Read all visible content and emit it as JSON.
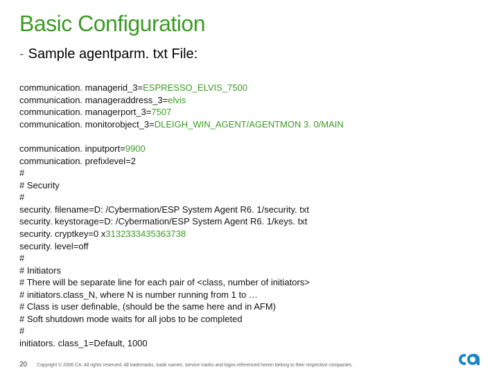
{
  "title": "Basic Configuration",
  "subtitle_dash": "-",
  "subtitle": "Sample agentparm. txt File:",
  "block1": [
    {
      "key": "communication. managerid_3",
      "value": "ESPRESSO_ELVIS_7500",
      "green": true
    },
    {
      "key": "communication. manageraddress_3",
      "value": "elvis",
      "green": true
    },
    {
      "key": "communication. managerport_3",
      "value": "7507",
      "green": true
    },
    {
      "key": "communication. monitorobject_3",
      "value": "DLEIGH_WIN_AGENT/AGENTMON 3. 0/MAIN",
      "green": true
    }
  ],
  "block2": [
    {
      "key": "communication. inputport",
      "value": "9900",
      "green": true
    },
    {
      "key": "communication. prefixlevel",
      "value": "2",
      "green": false
    },
    {
      "raw": "#"
    },
    {
      "raw": "# Security"
    },
    {
      "raw": "#"
    },
    {
      "key": "security. filename",
      "value": "D: /Cybermation/ESP System Agent R6. 1/security. txt",
      "green": false
    },
    {
      "key": "security. keystorage",
      "value": "D: /Cybermation/ESP System Agent R6. 1/keys. txt",
      "green": false
    },
    {
      "key": "security. cryptkey",
      "value_prefix": "0 x",
      "value": "3132333435363738",
      "green": true
    },
    {
      "key": "security. level",
      "value": "off",
      "green": false
    },
    {
      "raw": "#"
    },
    {
      "raw": "# Initiators"
    },
    {
      "raw": "# There will be separate line for each pair of <class, number of initiators>"
    },
    {
      "raw": "# initiators.class_N, where N is number running from 1 to …"
    },
    {
      "raw": "# Class is user definable, (should be the same here and in AFM)"
    },
    {
      "raw": "# Soft shutdown mode waits for all jobs to be completed"
    },
    {
      "raw": "#"
    },
    {
      "key": "initiators. class_1",
      "value": "Default, 1000",
      "green": false
    }
  ],
  "footer": {
    "page": "20",
    "copyright": "Copyright © 2006 CA. All rights reserved. All trademarks, trade names, service marks and logos referenced herein belong to their respective companies."
  },
  "logo_name": "ca"
}
